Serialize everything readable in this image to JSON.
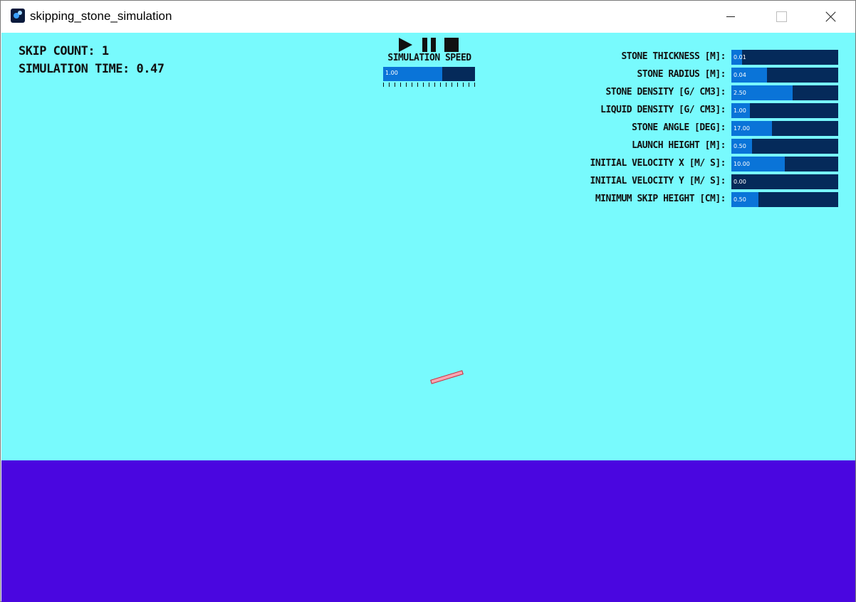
{
  "window": {
    "title": "skipping_stone_simulation"
  },
  "stats": {
    "skip_count": "SKIP COUNT: 1",
    "simulation_time": "SIMULATION TIME: 0.47"
  },
  "controls": {
    "play_icon": "play-icon",
    "pause_icon": "pause-icon",
    "stop_icon": "stop-icon",
    "speed_label": "SIMULATION SPEED",
    "speed_value": "1.00",
    "speed_fraction": 0.64
  },
  "parameters": [
    {
      "label": "STONE THICKNESS [M]:",
      "value": "0.01",
      "fraction": 0.1
    },
    {
      "label": "STONE RADIUS [M]:",
      "value": "0.04",
      "fraction": 0.33
    },
    {
      "label": "STONE DENSITY [G/ CM3]:",
      "value": "2.50",
      "fraction": 0.57
    },
    {
      "label": "LIQUID DENSITY [G/ CM3]:",
      "value": "1.00",
      "fraction": 0.17
    },
    {
      "label": "STONE ANGLE [DEG]:",
      "value": "17.00",
      "fraction": 0.38
    },
    {
      "label": "LAUNCH HEIGHT [M]:",
      "value": "0.50",
      "fraction": 0.19
    },
    {
      "label": "INITIAL VELOCITY X [M/ S]:",
      "value": "10.00",
      "fraction": 0.5
    },
    {
      "label": "INITIAL VELOCITY Y [M/ S]:",
      "value": "0.00",
      "fraction": 0.0
    },
    {
      "label": "MINIMUM SKIP HEIGHT [CM]:",
      "value": "0.50",
      "fraction": 0.25
    }
  ],
  "colors": {
    "sky": "#78fafd",
    "water": "#4a06e0",
    "slider_track": "#052a5a",
    "slider_fill": "#0a74d8",
    "stone_fill": "#f6a6b2",
    "stone_outline": "#c0303f"
  }
}
